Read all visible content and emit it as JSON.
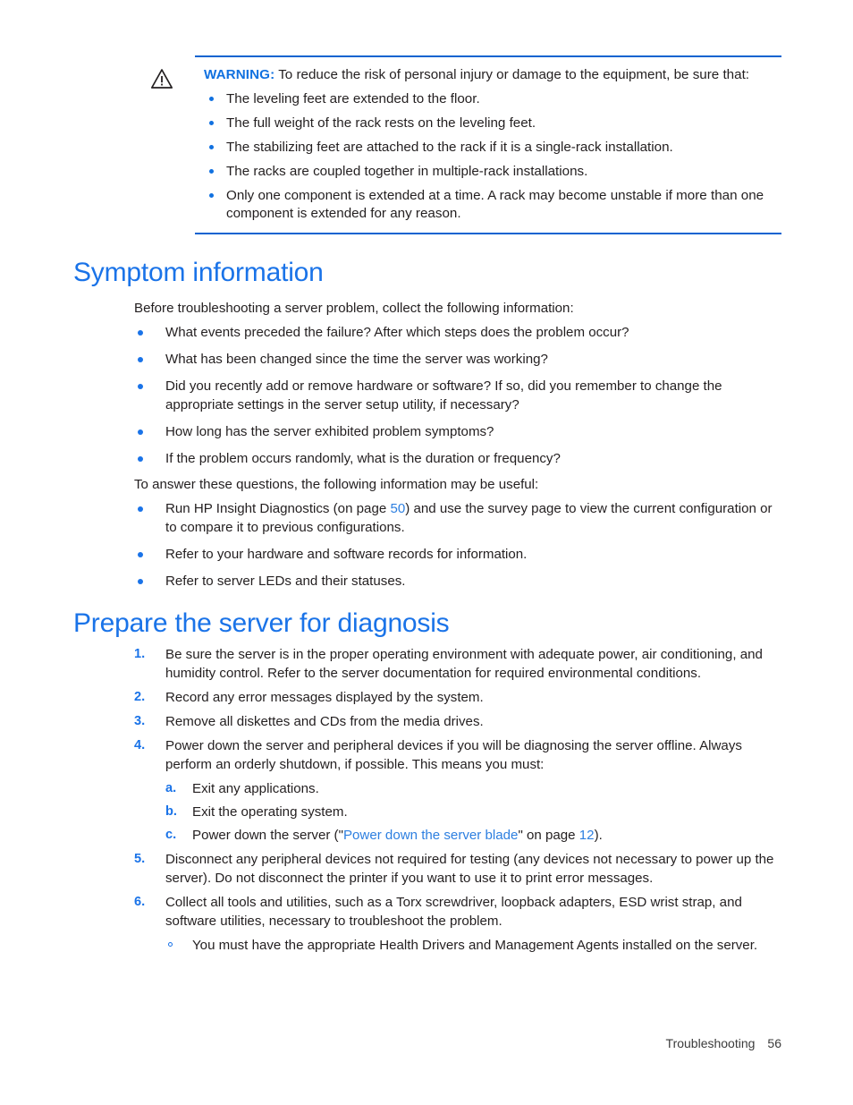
{
  "document": {
    "warning": {
      "icon": "warning-triangle-icon",
      "label": "WARNING:",
      "lead": "To reduce the risk of personal injury or damage to the equipment, be sure that:",
      "items": [
        "The leveling feet are extended to the floor.",
        "The full weight of the rack rests on the leveling feet.",
        "The stabilizing feet are attached to the rack if it is a single-rack installation.",
        "The racks are coupled together in multiple-rack installations.",
        "Only one component is extended at a time. A rack may become unstable if more than one component is extended for any reason."
      ]
    },
    "section_symptom": {
      "heading": "Symptom information",
      "intro": "Before troubleshooting a server problem, collect the following information:",
      "questions": [
        "What events preceded the failure? After which steps does the problem occur?",
        "What has been changed since the time the server was working?",
        "Did you recently add or remove hardware or software? If so, did you remember to change the appropriate settings in the server setup utility, if necessary?",
        "How long has the server exhibited problem symptoms?",
        "If the problem occurs randomly, what is the duration or frequency?"
      ],
      "answer_intro": "To answer these questions, the following information may be useful:",
      "useful_1_pre": "Run HP Insight Diagnostics (on page ",
      "useful_1_link": "50",
      "useful_1_post": ") and use the survey page to view the current configuration or to compare it to previous configurations.",
      "useful_2": "Refer to your hardware and software records for information.",
      "useful_3": "Refer to server LEDs and their statuses."
    },
    "section_prepare": {
      "heading": "Prepare the server for diagnosis",
      "steps": [
        {
          "num": "1.",
          "text": "Be sure the server is in the proper operating environment with adequate power, air conditioning, and humidity control. Refer to the server documentation for required environmental conditions."
        },
        {
          "num": "2.",
          "text": "Record any error messages displayed by the system."
        },
        {
          "num": "3.",
          "text": "Remove all diskettes and CDs from the media drives."
        },
        {
          "num": "4.",
          "text": "Power down the server and peripheral devices if you will be diagnosing the server offline. Always perform an orderly shutdown, if possible. This means you must:"
        },
        {
          "num": "5.",
          "text": "Disconnect any peripheral devices not required for testing (any devices not necessary to power up the server). Do not disconnect the printer if you want to use it to print error messages."
        },
        {
          "num": "6.",
          "text": "Collect all tools and utilities, such as a Torx screwdriver, loopback adapters, ESD wrist strap, and software utilities, necessary to troubleshoot the problem."
        }
      ],
      "substeps": [
        {
          "num": "a.",
          "text": "Exit any applications."
        },
        {
          "num": "b.",
          "text": "Exit the operating system."
        }
      ],
      "substep_c": {
        "num": "c.",
        "pre": "Power down the server (\"",
        "link": "Power down the server blade",
        "mid": "\" on page ",
        "page": "12",
        "post": ")."
      },
      "subbullet": "You must have the appropriate Health Drivers and Management Agents installed on the server."
    },
    "footer": {
      "chapter": "Troubleshooting",
      "page_number": "56"
    },
    "colors": {
      "heading_blue": "#1a73e8",
      "rule_blue": "#0b63d0",
      "link_blue": "#2d7fe0",
      "body_text": "#231f20"
    }
  }
}
